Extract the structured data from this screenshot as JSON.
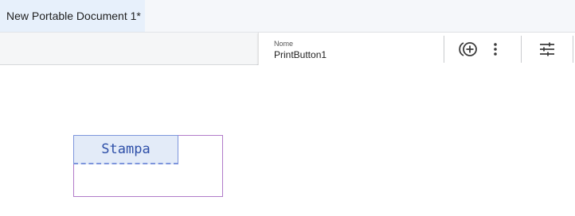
{
  "document": {
    "tab_title": "New Portable Document 1*"
  },
  "properties": {
    "name_label": "Nome",
    "name_value": "PrintButton1",
    "icons": [
      "add-action-icon",
      "more-vert-icon",
      "tune-icon"
    ]
  },
  "canvas": {
    "button_label": "Stampa",
    "colors": {
      "button_fill": "#e3ebf8",
      "button_border": "#7d95dc",
      "button_text": "#2e4fa8",
      "field_border": "#b17bc9"
    }
  }
}
